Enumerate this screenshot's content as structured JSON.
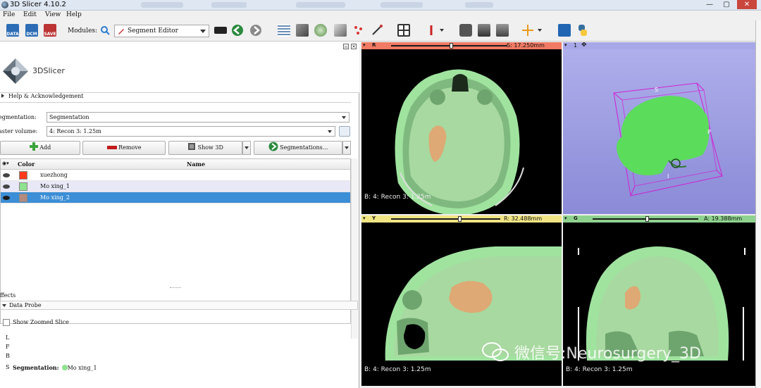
{
  "window": {
    "title": "3D Slicer 4.10.2",
    "minimize": "—",
    "maximize": "▢",
    "close": "✕"
  },
  "menu": [
    "File",
    "Edit",
    "View",
    "Help"
  ],
  "toolbar": {
    "data_label": "DATA",
    "dcm_label": "DCM",
    "save_label": "SAVE",
    "modules_label": "Modules:",
    "modules_value": "Segment Editor"
  },
  "logo": {
    "text": "3DSlicer"
  },
  "help": {
    "label": "Help & Acknowledgement"
  },
  "segmentation": {
    "label": "egmentation:",
    "value": "Segmentation",
    "master_label": "aster volume:",
    "master_value": "4: Recon 3: 1.25m"
  },
  "actions": {
    "add": "Add",
    "remove": "Remove",
    "show3d": "Show 3D",
    "segmentations": "Segmentations..."
  },
  "table": {
    "col_color": "Color",
    "col_name": "Name",
    "rows": [
      {
        "name": "xuezhong",
        "color": "#ff3a1c"
      },
      {
        "name": "Mo xing_1",
        "color": "#8fe28f"
      },
      {
        "name": "Mo xing_2",
        "color": "#b48a7e"
      }
    ]
  },
  "effects_label": "ffects",
  "probe": {
    "title": "Data Probe",
    "zoom_label": "Show Zoomed Slice",
    "L": "L",
    "F": "F",
    "B": "B",
    "S": "S",
    "seg_key": "Segmentation:",
    "seg_val": "Mo xing_1"
  },
  "views": {
    "red": {
      "letter": "R",
      "value": "S: 17.250mm",
      "info": "B: 4: Recon 3: 1.25m",
      "color": "#f07a64"
    },
    "threed": {
      "letter": "1",
      "axis_s": "S",
      "axis_p": "P",
      "axis_i": "I",
      "color": "#a7a7e8"
    },
    "yellow": {
      "letter": "Y",
      "value": "R: 32.488mm",
      "info": "B: 4: Recon 3: 1.25m",
      "color": "#f1e483"
    },
    "green": {
      "letter": "G",
      "value": "A: 19.388mm",
      "info": "B: 4: Recon 3: 1.25m",
      "color": "#8fd28f"
    }
  },
  "watermark": "微信号:Neurosurgery_3D",
  "colors": {
    "selected_row": "#3c8ed6",
    "hover_row": "#e8e8f7",
    "tissue": "#9fe39f",
    "lesion": "#e3a36f"
  }
}
